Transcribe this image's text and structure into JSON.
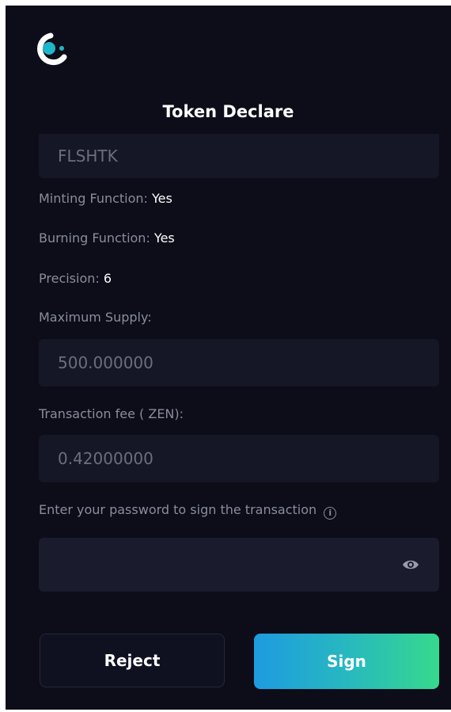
{
  "header": {
    "title": "Token Declare"
  },
  "token": {
    "symbol": "FLSHTK",
    "minting_label": "Minting Function:",
    "minting_value": "Yes",
    "burning_label": "Burning Function:",
    "burning_value": "Yes",
    "precision_label": "Precision:",
    "precision_value": "6",
    "max_supply_label": "Maximum Supply:",
    "max_supply_value": "500.000000",
    "fee_label": "Transaction fee ( ZEN):",
    "fee_value": "0.42000000"
  },
  "password": {
    "label": "Enter your password to sign the transaction",
    "info_icon": "info-icon",
    "toggle_icon": "eye-icon",
    "value": ""
  },
  "actions": {
    "reject_label": "Reject",
    "sign_label": "Sign"
  },
  "colors": {
    "background": "#0c0d19",
    "field": "#151626",
    "sign_gradient_start": "#1e9be0",
    "sign_gradient_end": "#36d98d",
    "logo_accent": "#1fb6c9"
  }
}
